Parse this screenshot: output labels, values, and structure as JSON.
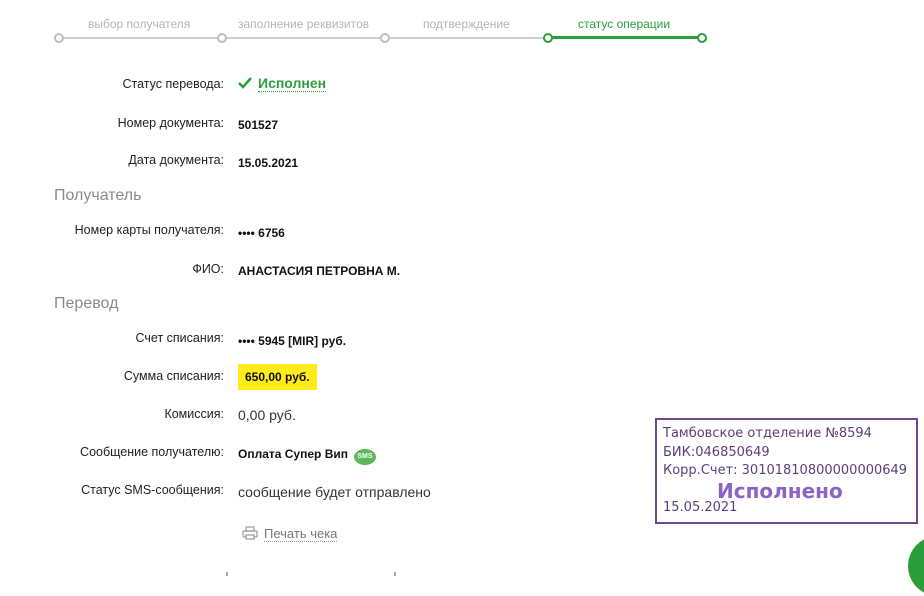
{
  "stepper": {
    "steps": [
      "выбор получателя",
      "заполнение реквизитов",
      "подтверждение",
      "статус операции"
    ],
    "active_index": 3,
    "colors": {
      "active": "#2b9e3b",
      "inactive": "#cfcfcf"
    }
  },
  "details": {
    "status_label": "Статус перевода:",
    "status_value": "Исполнен",
    "doc_number_label": "Номер документа:",
    "doc_number_value": "501527",
    "doc_date_label": "Дата документа:",
    "doc_date_value": "15.05.2021"
  },
  "recipient_section": {
    "title": "Получатель",
    "card_label": "Номер карты получателя:",
    "card_value": "•••• 6756",
    "name_label": "ФИО:",
    "name_value": "АНАСТАСИЯ ПЕТРОВНА М."
  },
  "transfer_section": {
    "title": "Перевод",
    "account_label": "Счет списания:",
    "account_value": "•••• 5945  [MIR]  руб.",
    "amount_label": "Сумма списания:",
    "amount_value": "650,00  руб.",
    "fee_label": "Комиссия:",
    "fee_value": "0,00 руб.",
    "message_label": "Сообщение получателю:",
    "message_value": "Оплата Супер Вип",
    "sms_badge": "SMS",
    "sms_status_label": "Статус SMS-сообщения:",
    "sms_status_value": "сообщение будет отправлено"
  },
  "print": {
    "label": "Печать чека",
    "icon": "printer-icon"
  },
  "stamp": {
    "line1": "Тамбовское отделение №8594",
    "line2": "БИК:046850649",
    "line3": "Корр.Счет: 30101810800000000649",
    "status": "Исполнено",
    "date": "15.05.2021",
    "color": "#6a4a8c"
  }
}
